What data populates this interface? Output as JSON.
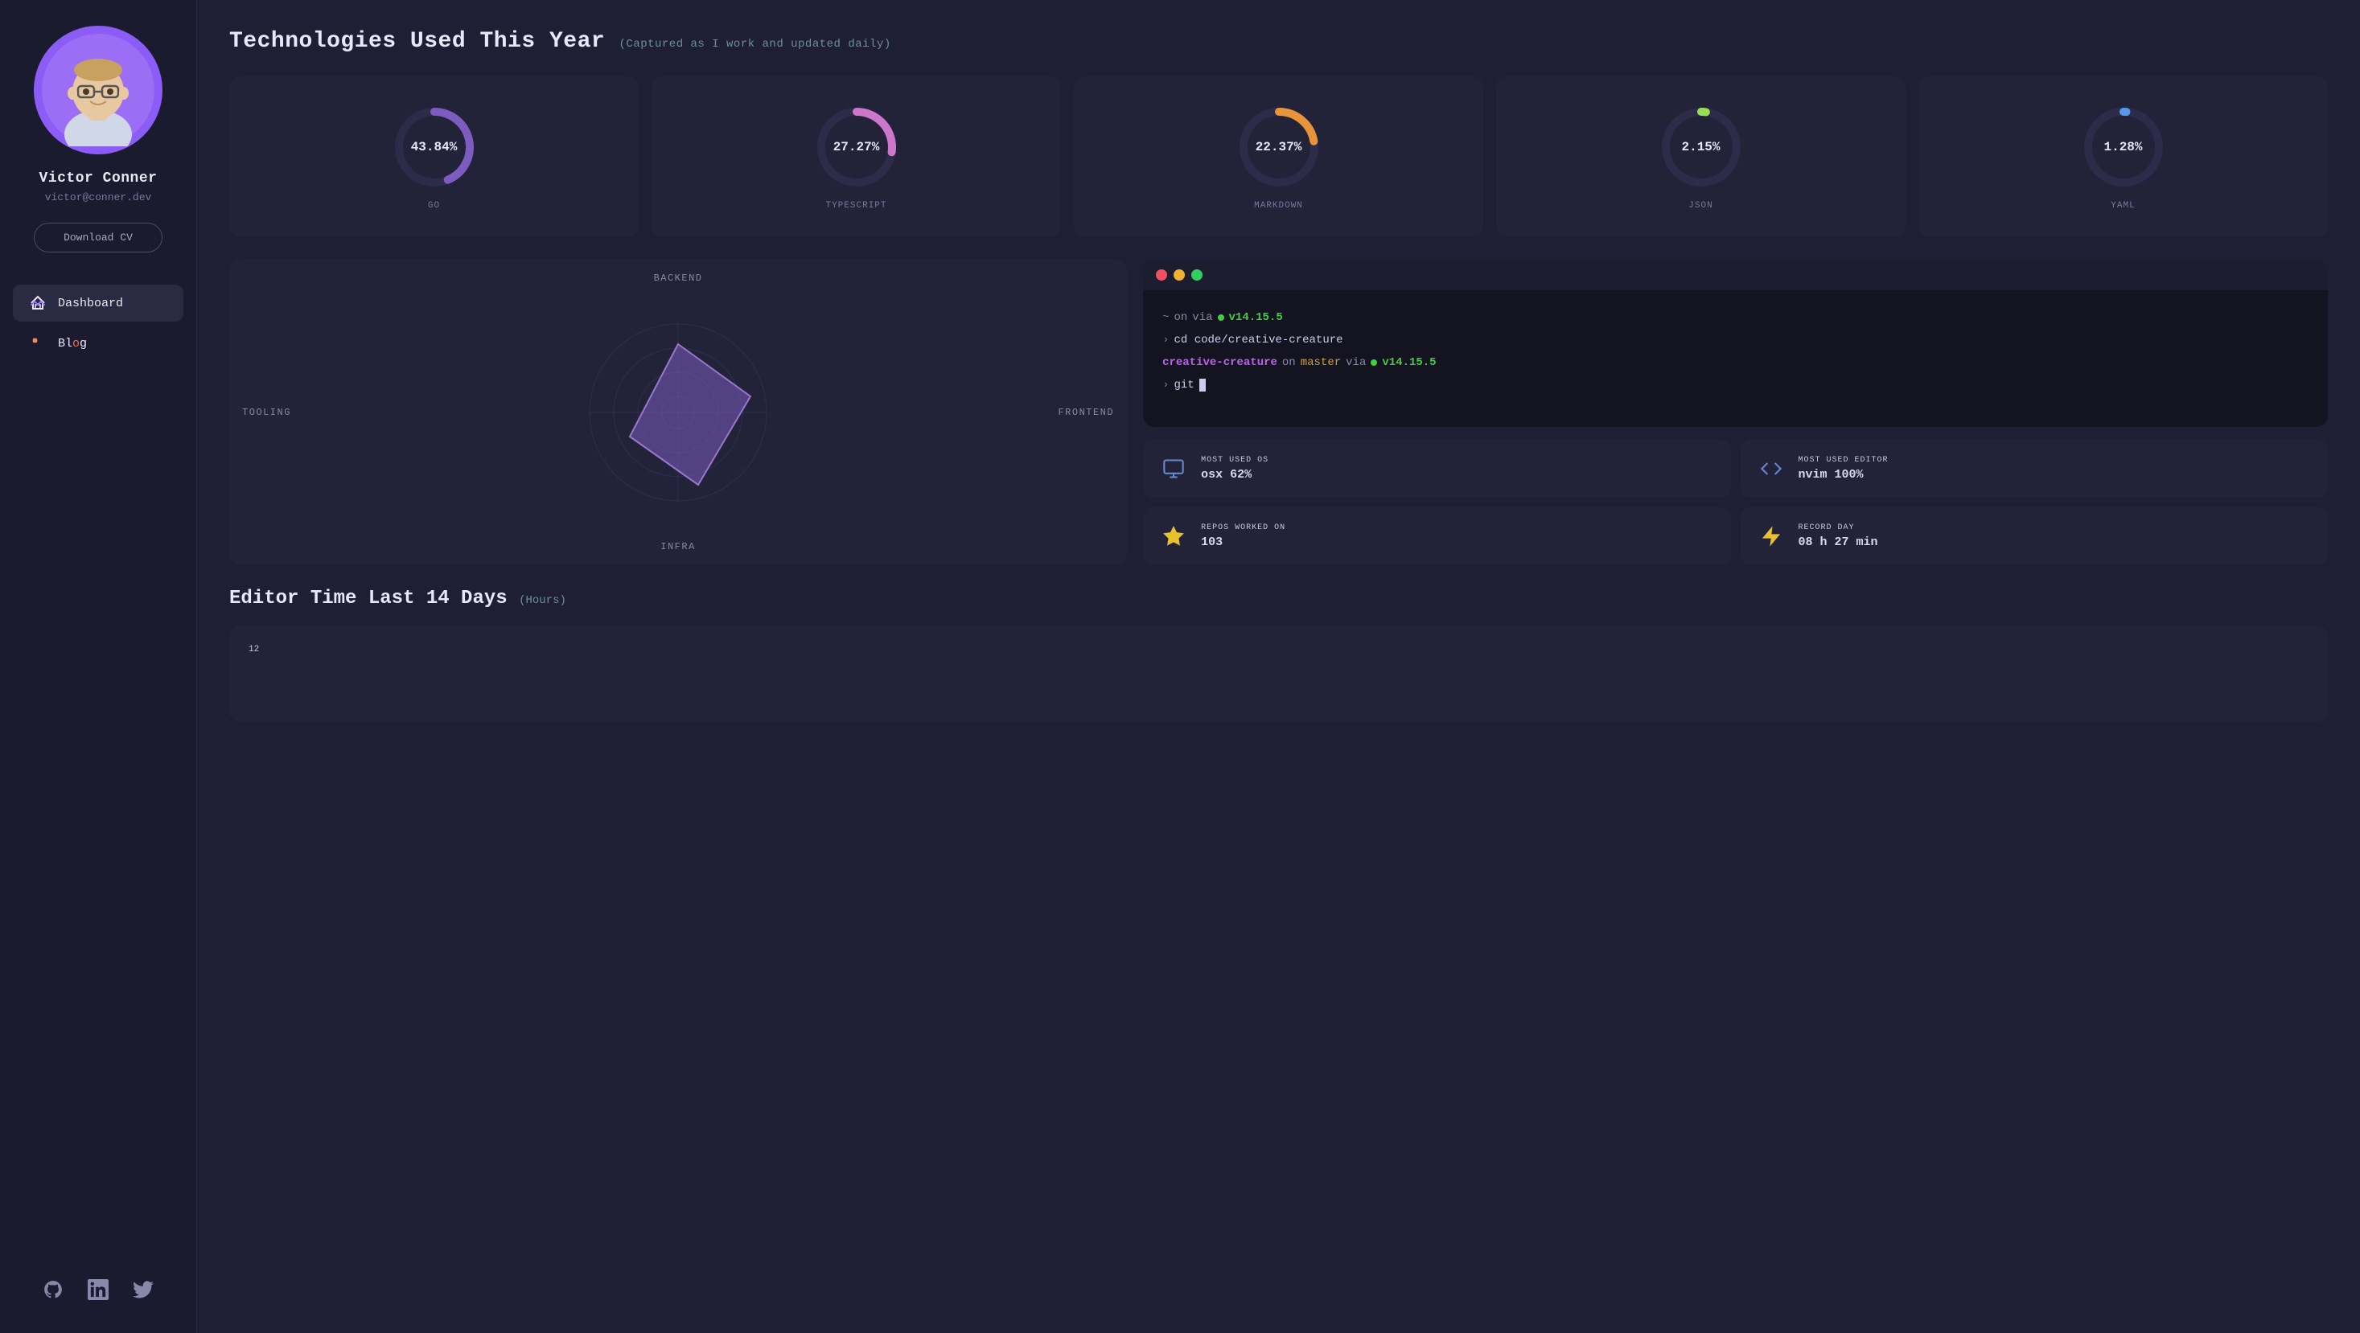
{
  "sidebar": {
    "user": {
      "name": "Victor Conner",
      "email": "victor@conner.dev",
      "download_cv_label": "Download CV"
    },
    "nav_items": [
      {
        "id": "dashboard",
        "label": "Dashboard",
        "active": true
      },
      {
        "id": "blog",
        "label": "Blog",
        "active": false
      }
    ],
    "social_links": [
      {
        "id": "github",
        "icon": "github-icon"
      },
      {
        "id": "linkedin",
        "icon": "linkedin-icon"
      },
      {
        "id": "twitter",
        "icon": "twitter-icon"
      }
    ]
  },
  "tech_section": {
    "title": "Technologies Used This Year",
    "subtitle": "(Captured as I work and updated daily)",
    "cards": [
      {
        "id": "go",
        "label": "GO",
        "percent": "43.84%",
        "value": 43.84,
        "color": "#7c5cbf",
        "bg_color": "#2e2a4a"
      },
      {
        "id": "typescript",
        "label": "TYPESCRIPT",
        "percent": "27.27%",
        "value": 27.27,
        "color": "#cc77cc",
        "bg_color": "#2e2a4a"
      },
      {
        "id": "markdown",
        "label": "MARKDOWN",
        "percent": "22.37%",
        "value": 22.37,
        "color": "#e8943a",
        "bg_color": "#2e2a4a"
      },
      {
        "id": "json",
        "label": "JSON",
        "percent": "2.15%",
        "value": 2.15,
        "color": "#99dd55",
        "bg_color": "#2e2a4a"
      },
      {
        "id": "yaml",
        "label": "YAML",
        "percent": "1.28%",
        "value": 1.28,
        "color": "#5599ee",
        "bg_color": "#2e2a4a"
      }
    ]
  },
  "radar_chart": {
    "labels": {
      "backend": "BACKEND",
      "frontend": "FRONTEND",
      "infra": "INFRA",
      "tooling": "TOOLING"
    }
  },
  "terminal": {
    "line1_tilde": "~",
    "line1_on": "on",
    "line1_via": "via",
    "line1_version": "v14.15.5",
    "line2_prompt": ">",
    "line2_cmd": "cd code/creative-creature",
    "line3_hostname": "creative-creature",
    "line3_on": "on",
    "line3_master": "master",
    "line3_via": "via",
    "line3_version": "v14.15.5",
    "line4_prompt": ">",
    "line4_cmd": "git"
  },
  "stat_cards": [
    {
      "id": "os",
      "label": "MOST USED OS",
      "value": "osx 62%",
      "icon": "monitor-icon"
    },
    {
      "id": "editor",
      "label": "MOST USED EDITOR",
      "value": "nvim 100%",
      "icon": "code-icon"
    },
    {
      "id": "repos",
      "label": "REPOS WORKED ON",
      "value": "103",
      "icon": "star-icon"
    },
    {
      "id": "record",
      "label": "RECORD DAY",
      "value": "08 h 27 min",
      "icon": "lightning-icon"
    }
  ],
  "editor_section": {
    "title": "Editor Time Last 14 Days",
    "hours_label": "(Hours)",
    "y_label": "12"
  },
  "colors": {
    "bg_main": "#1e1f35",
    "bg_sidebar": "#1a1b2e",
    "bg_card": "#222338",
    "accent_purple": "#7c5cbf",
    "accent_pink": "#cc77cc",
    "accent_orange": "#e8943a",
    "accent_green": "#99dd55",
    "accent_blue": "#5599ee",
    "text_primary": "#e8e8f8",
    "text_secondary": "#8888aa",
    "text_muted": "#5568888"
  }
}
